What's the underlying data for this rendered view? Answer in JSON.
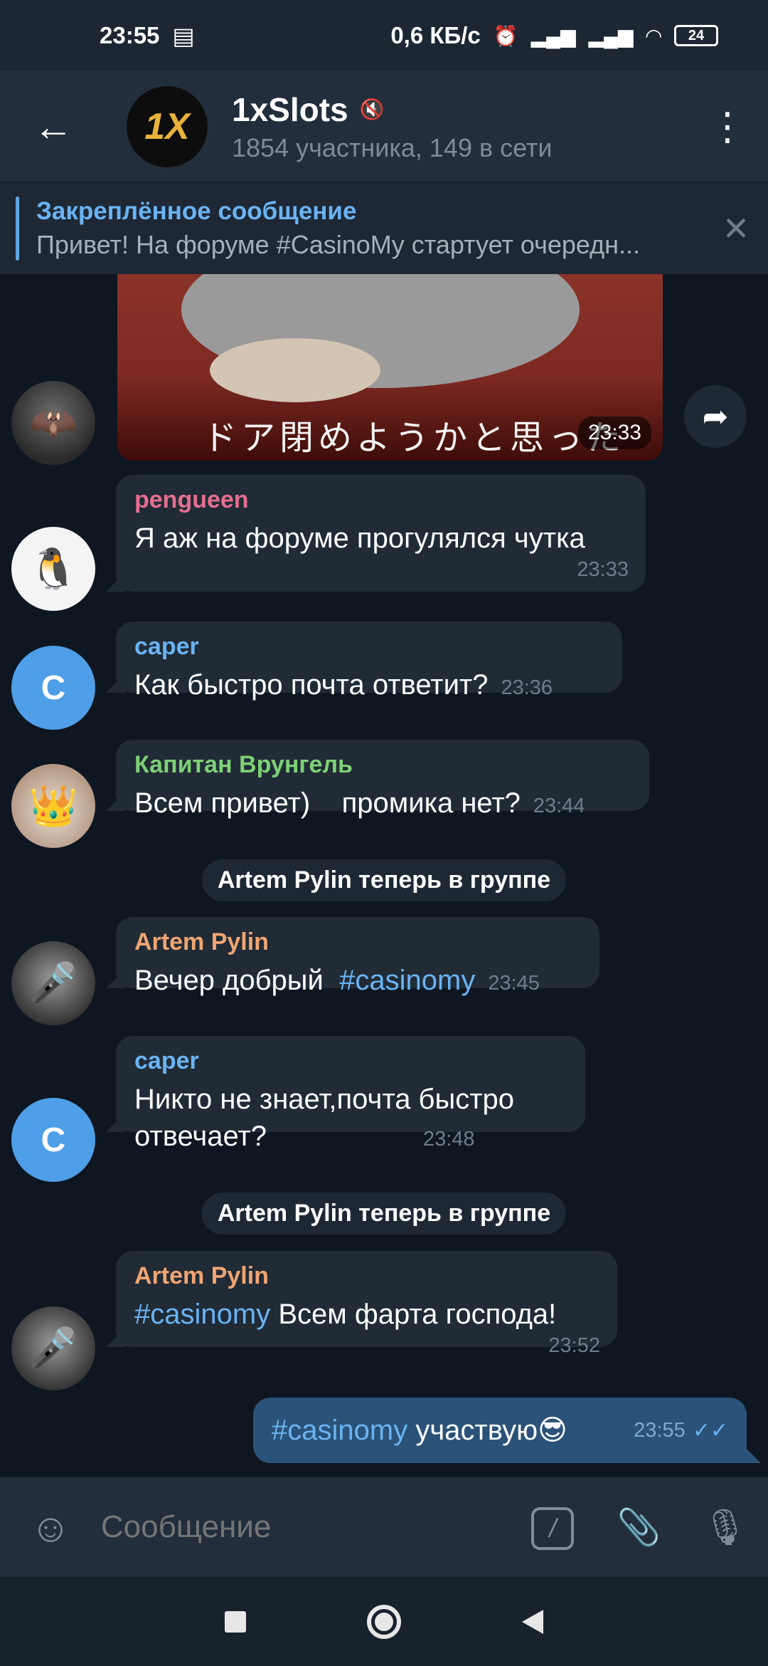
{
  "status_bar": {
    "time": "23:55",
    "notification_icon": "news-icon",
    "speed": "0,6 КБ/с",
    "battery": "24"
  },
  "header": {
    "title": "1xSlots",
    "avatar_text": "1X",
    "subtitle": "1854 участника, 149 в сети"
  },
  "pinned": {
    "title": "Закреплённое сообщение",
    "preview": "Привет! На форуме #CasinoMy стартует очередн..."
  },
  "media_message": {
    "caption": "ドア閉めようかと思った",
    "time": "23:33"
  },
  "messages": [
    {
      "sender": "pengueen",
      "sender_color": "#e56f8f",
      "text": "Я аж на форуме прогулялся чутка",
      "time": "23:33"
    },
    {
      "sender": "caper",
      "sender_color": "#6ab3f3",
      "avatar_letter": "C",
      "text": "Как быстро почта ответит?",
      "time": "23:36"
    },
    {
      "sender": "Капитан Врунгель",
      "sender_color": "#7ed076",
      "text": "Всем привет)    промика нет?",
      "time": "23:44"
    },
    {
      "service": "Artem Pylin теперь в группе"
    },
    {
      "sender": "Artem Pylin",
      "sender_color": "#f0a572",
      "text": "Вечер добрый",
      "hashtag": "#casinomy",
      "time": "23:45"
    },
    {
      "sender": "caper",
      "sender_color": "#6ab3f3",
      "avatar_letter": "C",
      "text_line1": "Никто не знает,почта быстро",
      "text_line2": "отвечает?",
      "time": "23:48"
    },
    {
      "service": "Artem Pylin теперь в группе"
    },
    {
      "sender": "Artem Pylin",
      "sender_color": "#f0a572",
      "hashtag": "#casinomy",
      "text": " Всем фарта господа!",
      "time": "23:52"
    }
  ],
  "outgoing": {
    "hashtag": "#casinomy",
    "text": " участвую😎",
    "time": "23:55"
  },
  "input": {
    "placeholder": "Сообщение"
  }
}
